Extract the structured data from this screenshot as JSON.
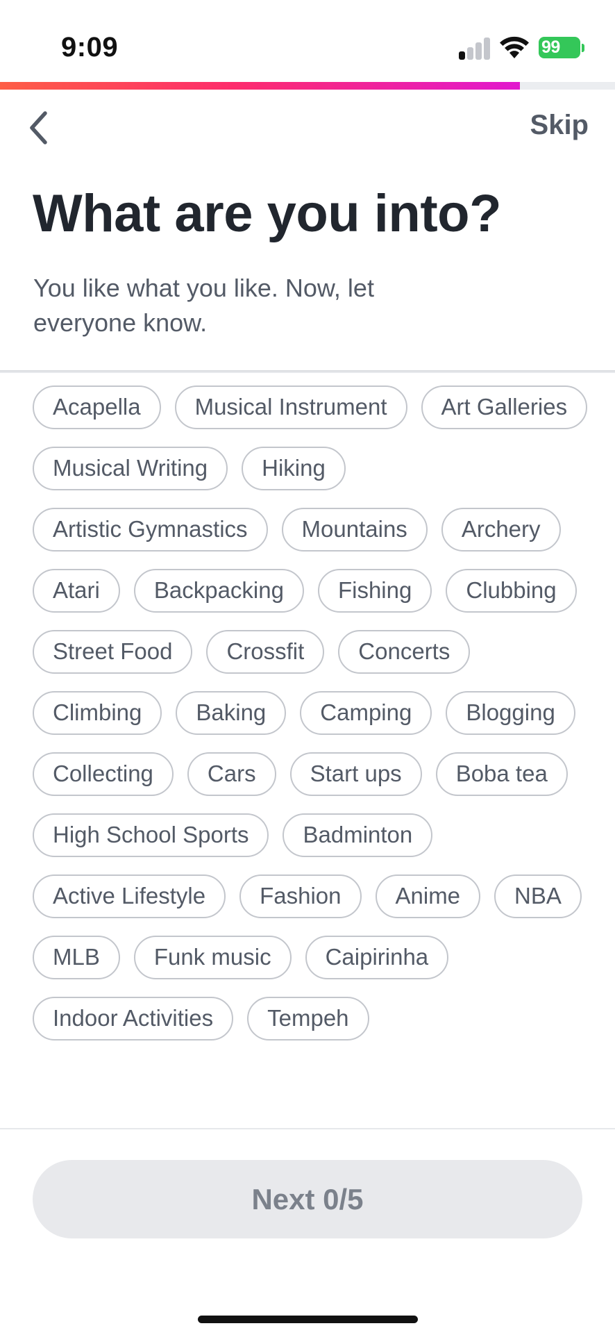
{
  "status_bar": {
    "time": "9:09",
    "battery": "99"
  },
  "progress": {
    "fraction": 0.845
  },
  "nav": {
    "back_icon": "chevron-left-icon",
    "skip_label": "Skip"
  },
  "header": {
    "title": "What are you into?",
    "subtitle": "You like what you like. Now, let everyone know."
  },
  "interests": [
    "Acapella",
    "Musical Instrument",
    "Art Galleries",
    "Musical Writing",
    "Hiking",
    "Artistic Gymnastics",
    "Mountains",
    "Archery",
    "Atari",
    "Backpacking",
    "Fishing",
    "Clubbing",
    "Street Food",
    "Crossfit",
    "Concerts",
    "Climbing",
    "Baking",
    "Camping",
    "Blogging",
    "Collecting",
    "Cars",
    "Start ups",
    "Boba tea",
    "High School Sports",
    "Badminton",
    "Active Lifestyle",
    "Fashion",
    "Anime",
    "NBA",
    "MLB",
    "Funk music",
    "Caipirinha",
    "Indoor Activities",
    "Tempeh"
  ],
  "footer": {
    "next_label": "Next 0/5"
  },
  "colors": {
    "progress_start": "#fd5e46",
    "progress_end": "#e119cf",
    "chip_border": "#c3c6cc",
    "button_disabled_bg": "#e8e9ec"
  }
}
